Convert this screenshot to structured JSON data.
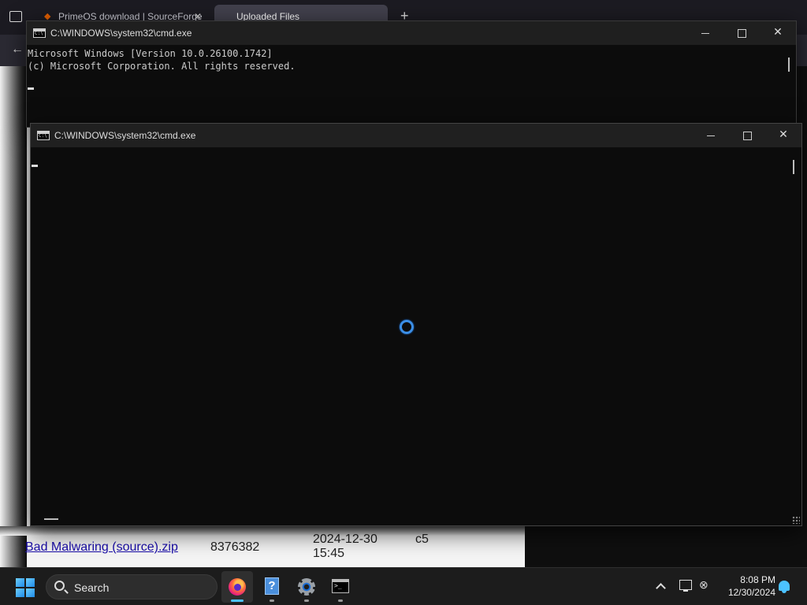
{
  "browser": {
    "tabs": [
      {
        "label": "PrimeOS download | SourceForge"
      },
      {
        "label": "Uploaded Files"
      }
    ],
    "new_tab_label": "+",
    "file_row": {
      "name": "Bad Malwaring (source).zip",
      "size": "8376382",
      "date": "2024-12-30 15:45",
      "extra": "c5"
    }
  },
  "cmd_back": {
    "title": "C:\\WINDOWS\\system32\\cmd.exe",
    "lines": [
      "Microsoft Windows [Version 10.0.26100.1742]",
      "(c) Microsoft Corporation. All rights reserved."
    ]
  },
  "cmd_front": {
    "title": "C:\\WINDOWS\\system32\\cmd.exe",
    "status": "loading"
  },
  "window_controls": {
    "close": "✕"
  },
  "taskbar": {
    "search_label": "Search",
    "apps": [
      {
        "icon": "firefox-icon",
        "active": true
      },
      {
        "icon": "help-icon",
        "active": false
      },
      {
        "icon": "gear-icon",
        "active": false
      },
      {
        "icon": "terminal-icon",
        "active": false
      }
    ],
    "help_glyph": "?",
    "time": "8:08 PM",
    "date": "12/30/2024"
  },
  "colors": {
    "accent": "#4cc2ff",
    "spinner": "#3b8ee6",
    "terminal_bg": "#0c0c0c"
  }
}
